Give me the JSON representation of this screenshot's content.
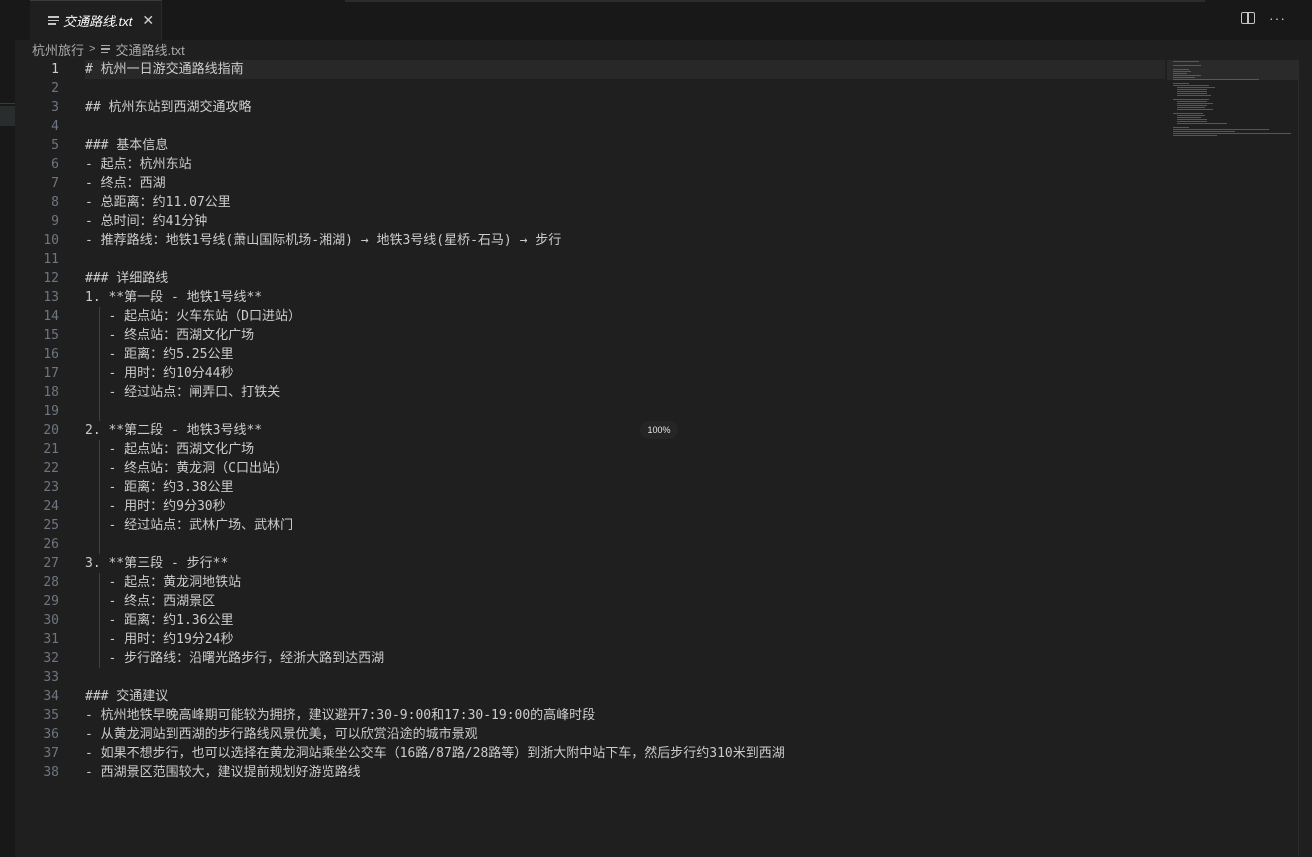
{
  "tab": {
    "title": "交通路线.txt",
    "close_glyph": "✕"
  },
  "breadcrumb": {
    "folder": "杭州旅行",
    "file": "交通路线.txt"
  },
  "zoom": "100%",
  "active_line": 1,
  "lines": [
    "# 杭州一日游交通路线指南",
    "",
    "## 杭州东站到西湖交通攻略",
    "",
    "### 基本信息",
    "- 起点：杭州东站",
    "- 终点：西湖",
    "- 总距离：约11.07公里",
    "- 总时间：约41分钟",
    "- 推荐路线：地铁1号线(萧山国际机场-湘湖) → 地铁3号线(星桥-石马) → 步行",
    "",
    "### 详细路线",
    "1. **第一段 - 地铁1号线**",
    "   - 起点站：火车东站（D口进站）",
    "   - 终点站：西湖文化广场",
    "   - 距离：约5.25公里",
    "   - 用时：约10分44秒",
    "   - 经过站点：闸弄口、打铁关",
    "",
    "2. **第二段 - 地铁3号线**",
    "   - 起点站：西湖文化广场",
    "   - 终点站：黄龙洞（C口出站）",
    "   - 距离：约3.38公里",
    "   - 用时：约9分30秒",
    "   - 经过站点：武林广场、武林门",
    "",
    "3. **第三段 - 步行**",
    "   - 起点：黄龙洞地铁站",
    "   - 终点：西湖景区",
    "   - 距离：约1.36公里",
    "   - 用时：约19分24秒",
    "   - 步行路线：沿曙光路步行，经浙大路到达西湖",
    "",
    "### 交通建议",
    "- 杭州地铁早晚高峰期可能较为拥挤，建议避开7:30-9:00和17:30-19:00的高峰时段",
    "- 从黄龙洞站到西湖的步行路线风景优美，可以欣赏沿途的城市景观",
    "- 如果不想步行，也可以选择在黄龙洞站乘坐公交车（16路/87路/28路等）到浙大附中站下车，然后步行约310米到西湖",
    "- 西湖景区范围较大，建议提前规划好游览路线"
  ],
  "icons": {
    "tab_file": "file-text-icon",
    "split": "split-editor-icon",
    "more": "more-actions-icon",
    "chevron": "chevron-right-icon"
  }
}
